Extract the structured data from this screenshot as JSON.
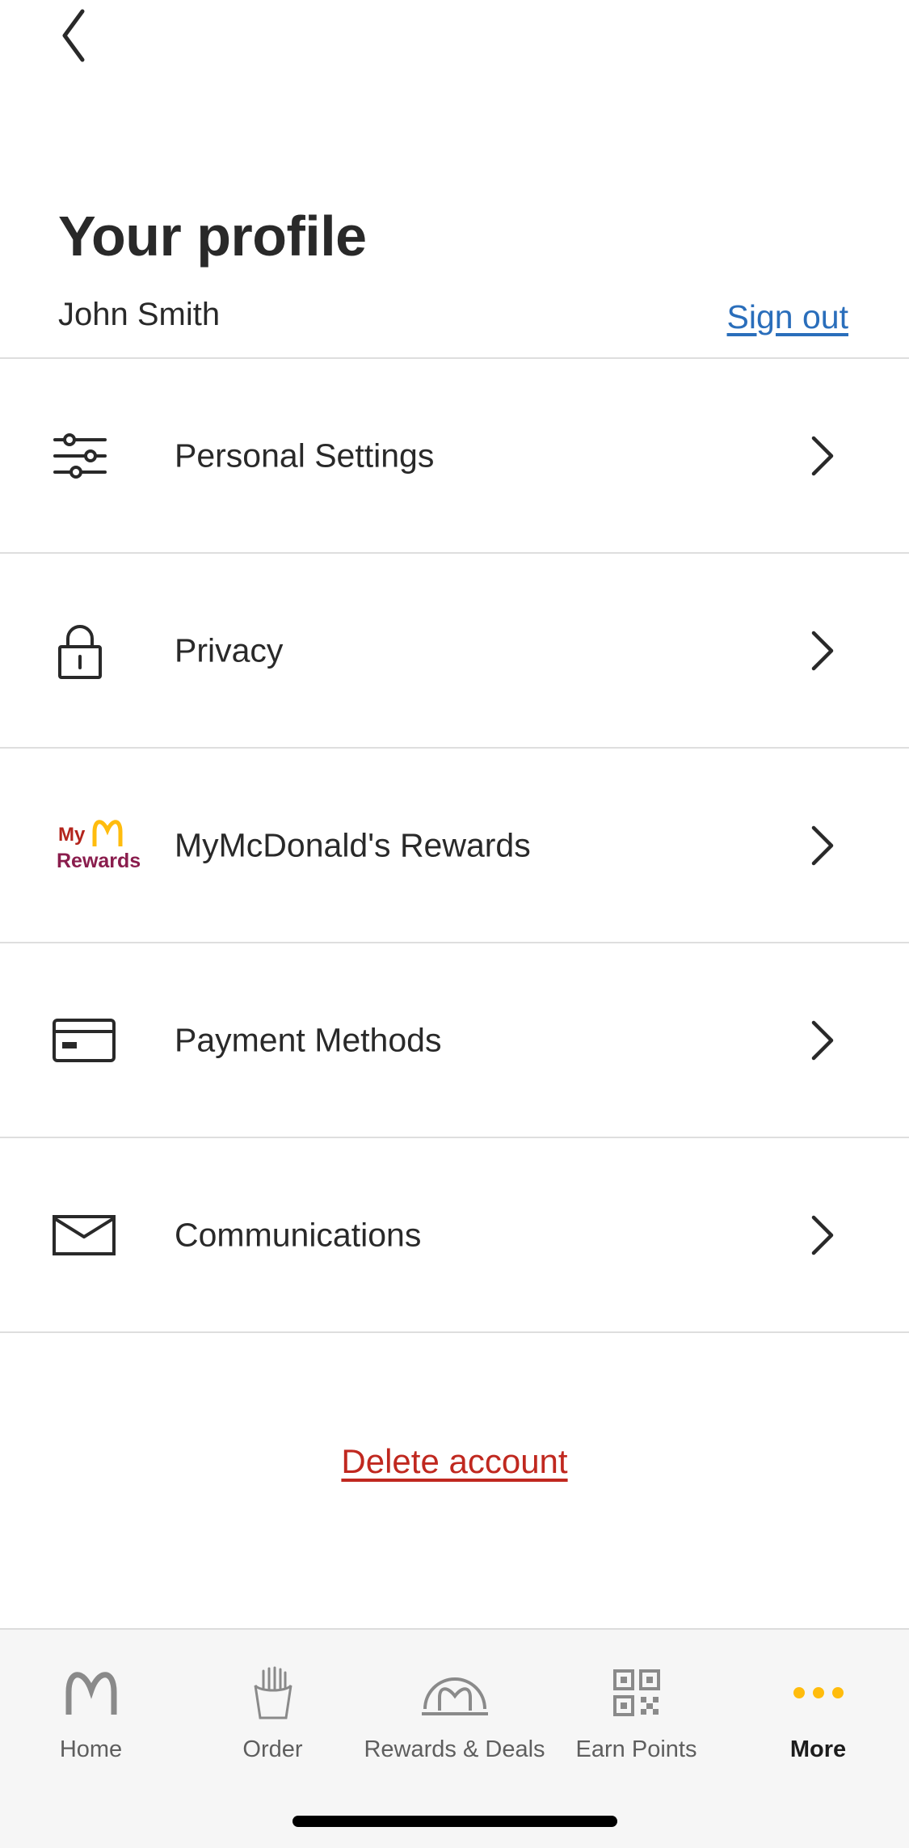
{
  "header": {
    "title": "Your profile",
    "user_name": "John Smith",
    "sign_out_label": "Sign out"
  },
  "menu": [
    {
      "label": "Personal Settings",
      "icon": "sliders-icon"
    },
    {
      "label": "Privacy",
      "icon": "lock-icon"
    },
    {
      "label": "MyMcDonald's Rewards",
      "icon": "mymcdonalds-rewards-logo"
    },
    {
      "label": "Payment Methods",
      "icon": "credit-card-icon"
    },
    {
      "label": "Communications",
      "icon": "envelope-icon"
    }
  ],
  "rewards_logo": {
    "line1": "My",
    "line2": "Rewards"
  },
  "delete_label": "Delete account",
  "tabs": [
    {
      "label": "Home",
      "icon": "golden-arches-icon"
    },
    {
      "label": "Order",
      "icon": "fries-icon"
    },
    {
      "label": "Rewards & Deals",
      "icon": "arches-arc-icon"
    },
    {
      "label": "Earn Points",
      "icon": "qr-code-icon"
    },
    {
      "label": "More",
      "icon": "more-dots-icon",
      "active": true
    }
  ],
  "colors": {
    "link_blue": "#2a6ebb",
    "delete_red": "#c0281f",
    "accent_yellow": "#ffbc0d",
    "tab_inactive": "#5e5e5e"
  }
}
